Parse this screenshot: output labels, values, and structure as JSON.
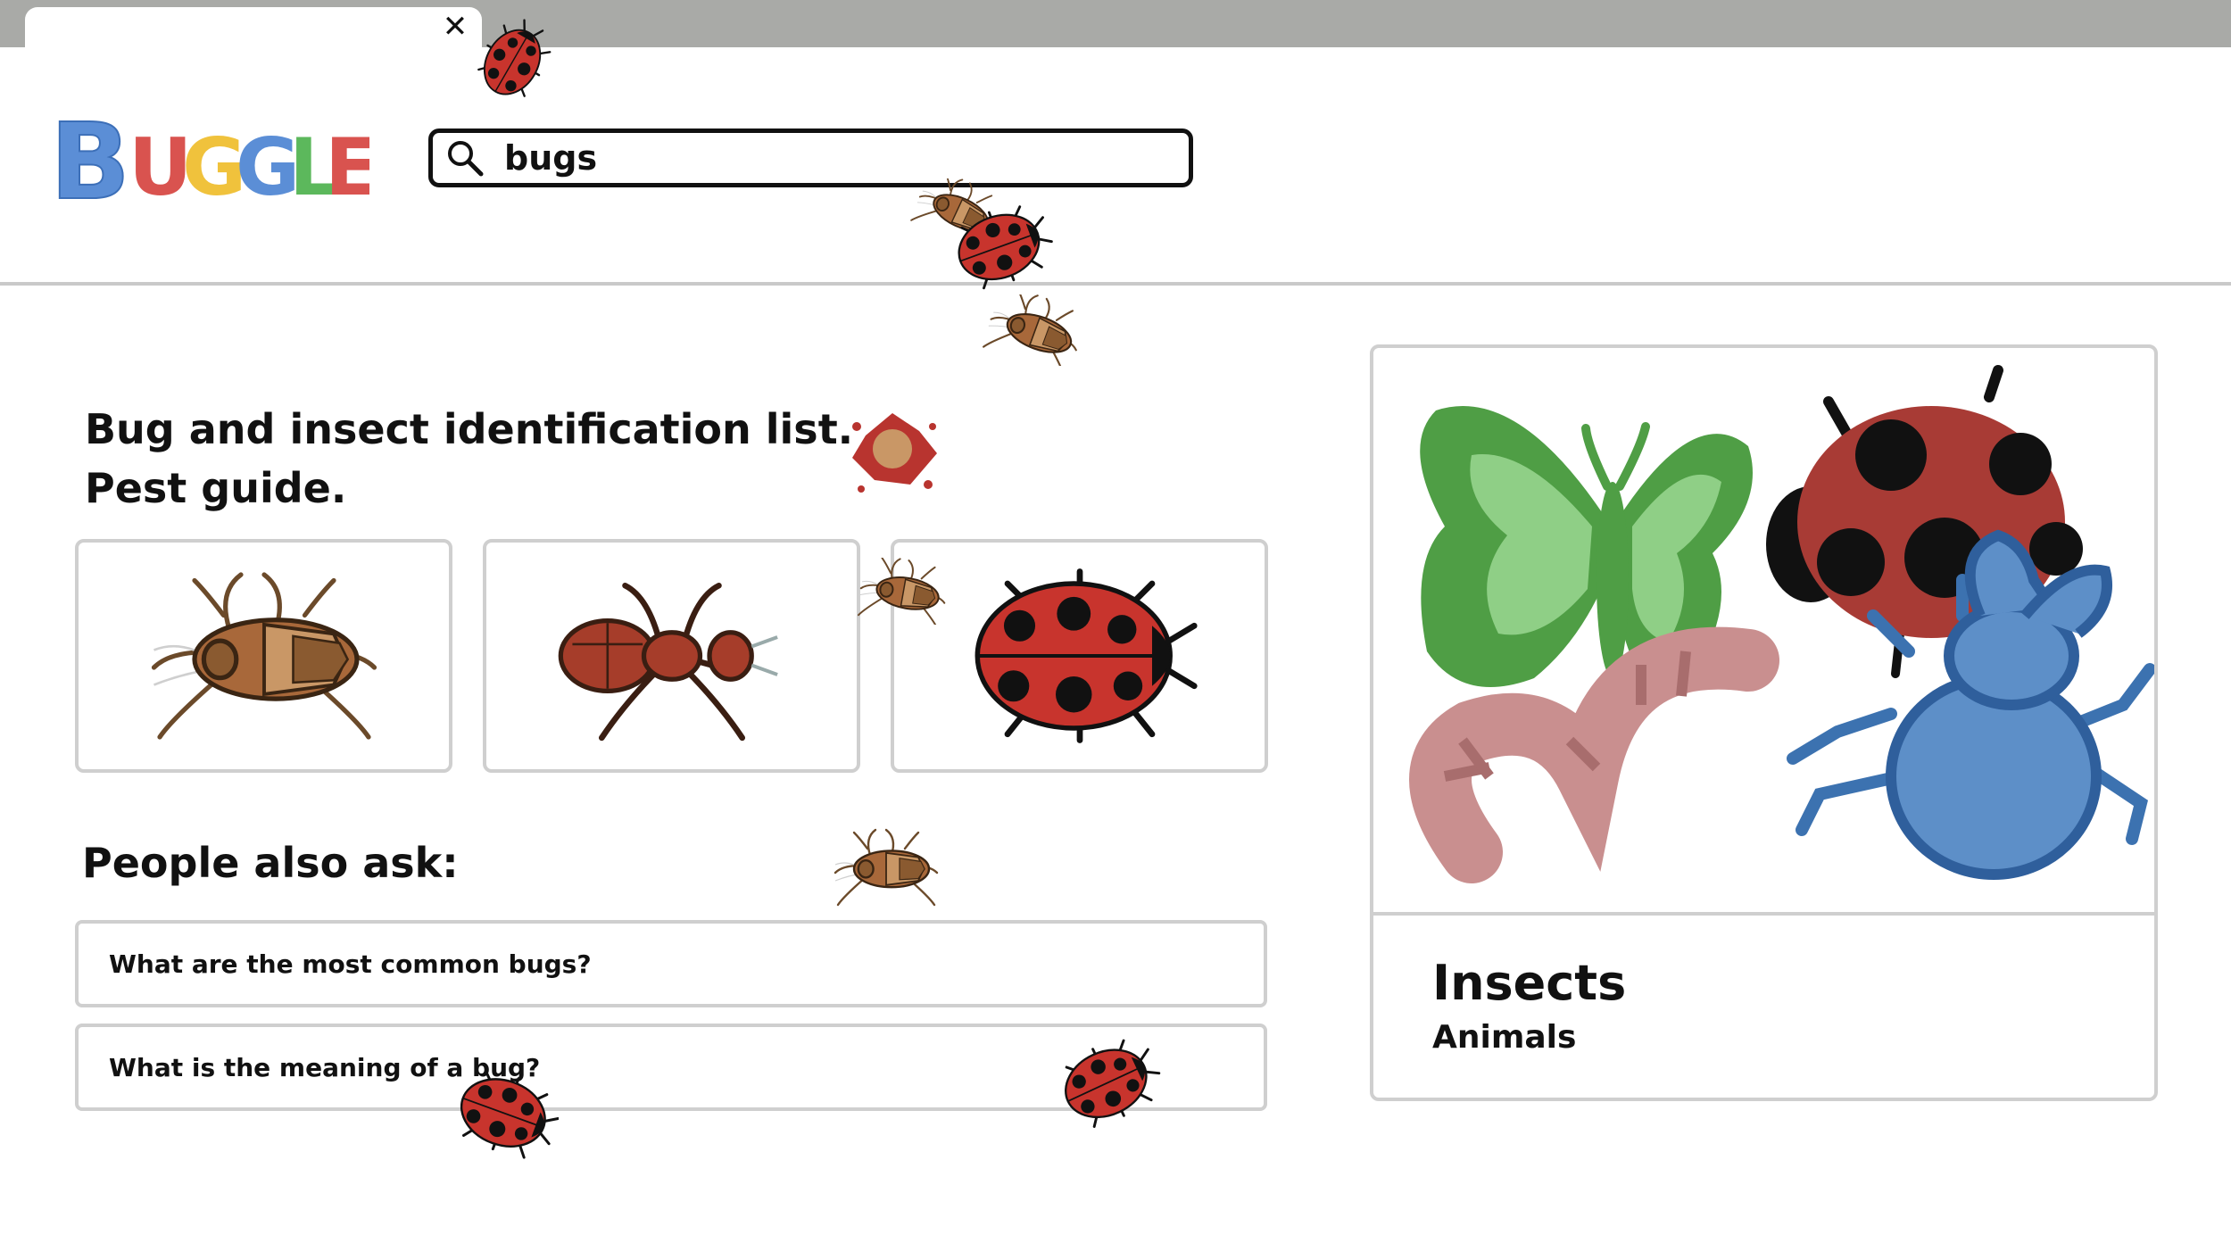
{
  "app": {
    "logo_text": "BUGGLE"
  },
  "search": {
    "query": "bugs"
  },
  "results": {
    "heading_line1": "Bug and insect identification list.",
    "heading_line2": "Pest guide.",
    "images": [
      {
        "icon": "cockroach-icon"
      },
      {
        "icon": "ant-icon"
      },
      {
        "icon": "ladybug-icon"
      }
    ],
    "people_also_ask": {
      "title": "People also ask:",
      "questions": [
        "What are the most common bugs?",
        "What is the meaning of a bug?"
      ]
    }
  },
  "knowledge_panel": {
    "title": "Insects",
    "subtitle": "Animals"
  },
  "colors": {
    "logo_blue": "#5b8ed6",
    "logo_red": "#d9534f",
    "logo_yellow": "#f0c23c",
    "logo_green": "#5cb85c",
    "ladybug_red": "#c8342d"
  }
}
